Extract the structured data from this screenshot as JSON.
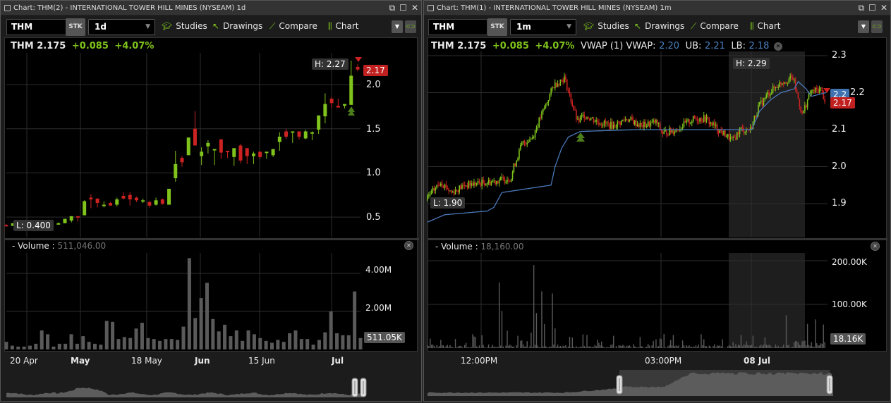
{
  "colors": {
    "up": "#7fc31c",
    "down": "#cc2222",
    "vwap": "#4a78b8",
    "grid": "#2e2e2e",
    "volume": "#5a5a5a",
    "price_tag": "#c02020",
    "vwap_tag": "#3f72b0"
  },
  "left": {
    "title": "Chart: THM(2) - INTERNATIONAL TOWER HILL MINES (NYSEAM) 1d",
    "symbol": "THM",
    "sec_type": "STK",
    "interval": "1d",
    "toolbar": {
      "studies": "Studies",
      "drawings": "Drawings",
      "compare": "Compare",
      "chart": "Chart"
    },
    "quote": {
      "symbol": "THM",
      "last": "2.175",
      "change": "+0.085",
      "change_pct": "+4.07%"
    },
    "high_label": "H: 2.27",
    "low_label": "L: 0.400",
    "price_tag": "2.17",
    "price_axis": [
      "2.0",
      "1.5",
      "1.0",
      "0.5"
    ],
    "volume": {
      "label": "- Volume :",
      "value": "511,046.00",
      "axis": [
        "4.00M",
        "2.00M"
      ],
      "tag": "511.05K"
    },
    "time_axis": [
      {
        "label": "20 Apr",
        "bold": false
      },
      {
        "label": "May",
        "bold": true
      },
      {
        "label": "18 May",
        "bold": false
      },
      {
        "label": "Jun",
        "bold": true
      },
      {
        "label": "15 Jun",
        "bold": false
      },
      {
        "label": "Jul",
        "bold": true
      }
    ]
  },
  "right": {
    "title": "Chart: THM(1) - INTERNATIONAL TOWER HILL MINES (NYSEAM) 1m",
    "symbol": "THM",
    "sec_type": "STK",
    "interval": "1m",
    "toolbar": {
      "studies": "Studies",
      "drawings": "Drawings",
      "compare": "Compare",
      "chart": "Chart"
    },
    "quote": {
      "symbol": "THM",
      "last": "2.175",
      "change": "+0.085",
      "change_pct": "+4.07%",
      "vwap_label": "VWAP (1) VWAP:",
      "vwap": "2.20",
      "ub_label": "UB:",
      "ub": "2.21",
      "lb_label": "LB:",
      "lb": "2.18"
    },
    "high_label": "H: 2.29",
    "low_label": "L: 1.90",
    "vwap_tag": "2.2",
    "price_tag": "2.17",
    "price_axis": [
      "2.3",
      "2.2",
      "2.1",
      "2.0",
      "1.9"
    ],
    "volume": {
      "label": "- Volume :",
      "value": "18,160.00",
      "axis": [
        "200.00K",
        "100.00K"
      ],
      "tag": "18.16K"
    },
    "time_axis": [
      {
        "label": "12:00PM",
        "bold": false
      },
      {
        "label": "03:00PM",
        "bold": false
      },
      {
        "label": "08 Jul",
        "bold": true
      }
    ]
  },
  "chart_data": [
    {
      "type": "candlestick",
      "name": "THM daily",
      "ylim": [
        0.3,
        2.35
      ],
      "ohlc": [
        [
          0.41,
          0.42,
          0.4,
          0.4
        ],
        [
          0.4,
          0.43,
          0.4,
          0.43
        ],
        [
          0.44,
          0.46,
          0.44,
          0.45
        ],
        [
          0.46,
          0.47,
          0.44,
          0.44
        ],
        [
          0.44,
          0.46,
          0.44,
          0.45
        ],
        [
          0.44,
          0.45,
          0.43,
          0.43
        ],
        [
          0.42,
          0.45,
          0.41,
          0.41
        ],
        [
          0.41,
          0.43,
          0.41,
          0.42
        ],
        [
          0.42,
          0.44,
          0.42,
          0.43
        ],
        [
          0.43,
          0.48,
          0.43,
          0.48
        ],
        [
          0.46,
          0.51,
          0.44,
          0.51
        ],
        [
          0.51,
          0.51,
          0.45,
          0.5
        ],
        [
          0.52,
          0.69,
          0.52,
          0.68
        ],
        [
          0.72,
          0.76,
          0.6,
          0.7
        ],
        [
          0.71,
          0.71,
          0.61,
          0.66
        ],
        [
          0.63,
          0.68,
          0.61,
          0.64
        ],
        [
          0.66,
          0.67,
          0.63,
          0.63
        ],
        [
          0.64,
          0.72,
          0.62,
          0.7
        ],
        [
          0.74,
          0.78,
          0.7,
          0.71
        ],
        [
          0.75,
          0.78,
          0.63,
          0.7
        ],
        [
          0.72,
          0.73,
          0.67,
          0.69
        ],
        [
          0.68,
          0.71,
          0.66,
          0.69
        ],
        [
          0.67,
          0.68,
          0.61,
          0.63
        ],
        [
          0.64,
          0.72,
          0.63,
          0.69
        ],
        [
          0.7,
          0.71,
          0.64,
          0.65
        ],
        [
          0.64,
          0.82,
          0.64,
          0.82
        ],
        [
          0.94,
          1.25,
          0.9,
          1.1
        ],
        [
          1.17,
          1.19,
          1.07,
          1.12
        ],
        [
          1.2,
          1.4,
          1.2,
          1.4
        ],
        [
          1.5,
          1.7,
          1.31,
          1.31
        ],
        [
          1.19,
          1.29,
          1.09,
          1.24
        ],
        [
          1.3,
          1.37,
          1.22,
          1.34
        ],
        [
          1.26,
          1.27,
          1.09,
          1.27
        ],
        [
          1.38,
          1.38,
          1.16,
          1.23
        ],
        [
          1.25,
          1.25,
          1.17,
          1.24
        ],
        [
          1.18,
          1.28,
          1.08,
          1.28
        ],
        [
          1.31,
          1.33,
          1.11,
          1.14
        ],
        [
          1.28,
          1.28,
          1.1,
          1.19
        ],
        [
          1.19,
          1.24,
          1.1,
          1.22
        ],
        [
          1.24,
          1.24,
          1.16,
          1.18
        ],
        [
          1.23,
          1.24,
          1.16,
          1.24
        ],
        [
          1.2,
          1.27,
          1.18,
          1.27
        ],
        [
          1.35,
          1.46,
          1.25,
          1.41
        ],
        [
          1.47,
          1.5,
          1.38,
          1.41
        ],
        [
          1.46,
          1.47,
          1.34,
          1.47
        ],
        [
          1.47,
          1.47,
          1.38,
          1.41
        ],
        [
          1.39,
          1.49,
          1.38,
          1.47
        ],
        [
          1.45,
          1.47,
          1.37,
          1.46
        ],
        [
          1.49,
          1.65,
          1.44,
          1.65
        ],
        [
          1.64,
          1.9,
          1.56,
          1.78
        ],
        [
          1.84,
          1.86,
          1.73,
          1.79
        ],
        [
          1.76,
          1.84,
          1.74,
          1.74
        ],
        [
          1.76,
          1.78,
          1.73,
          1.78
        ],
        [
          1.77,
          2.27,
          1.77,
          2.1
        ],
        [
          2.2,
          2.23,
          2.15,
          2.17
        ]
      ],
      "volume_m": [
        0.4,
        0.2,
        0.15,
        0.15,
        0.2,
        0.3,
        1.0,
        0.8,
        0.15,
        0.3,
        0.3,
        0.8,
        0.3,
        0.7,
        0.4,
        0.3,
        0.25,
        1.5,
        1.45,
        0.55,
        0.65,
        0.6,
        1.1,
        1.4,
        0.6,
        0.55,
        0.45,
        0.55,
        0.55,
        0.5,
        1.2,
        4.8,
        1.65,
        2.7,
        3.5,
        1.6,
        0.95,
        1.3,
        0.7,
        1.0,
        0.45,
        1.0,
        0.8,
        0.6,
        0.45,
        0.35,
        0.5,
        0.4,
        0.85,
        1.0,
        0.55,
        0.55,
        0.25,
        0.5,
        0.9,
        2.0,
        0.85,
        0.75,
        0.75,
        3.05,
        0.6
      ]
    },
    {
      "type": "candlestick",
      "name": "THM 1-minute",
      "bars": 300,
      "ylim": [
        1.84,
        2.31
      ],
      "price_path": [
        [
          0,
          1.91
        ],
        [
          11,
          1.96
        ],
        [
          19,
          1.93
        ],
        [
          29,
          1.95
        ],
        [
          50,
          1.96
        ],
        [
          64,
          1.97
        ],
        [
          66,
          2.0
        ],
        [
          72,
          2.06
        ],
        [
          80,
          2.08
        ],
        [
          88,
          2.15
        ],
        [
          96,
          2.22
        ],
        [
          104,
          2.24
        ],
        [
          109,
          2.18
        ],
        [
          114,
          2.12
        ],
        [
          119,
          2.14
        ],
        [
          130,
          2.12
        ],
        [
          141,
          2.11
        ],
        [
          151,
          2.13
        ],
        [
          162,
          2.11
        ],
        [
          173,
          2.12
        ],
        [
          178,
          2.09
        ],
        [
          188,
          2.1
        ],
        [
          202,
          2.13
        ],
        [
          210,
          2.13
        ],
        [
          220,
          2.1
        ],
        [
          231,
          2.07
        ],
        [
          236,
          2.1
        ],
        [
          244,
          2.1
        ],
        [
          250,
          2.16
        ],
        [
          258,
          2.2
        ],
        [
          268,
          2.23
        ],
        [
          276,
          2.24
        ],
        [
          283,
          2.14
        ],
        [
          289,
          2.2
        ],
        [
          297,
          2.21
        ],
        [
          300,
          2.18
        ]
      ],
      "vwap_path": [
        [
          0,
          1.85
        ],
        [
          13,
          1.87
        ],
        [
          45,
          1.88
        ],
        [
          50,
          1.89
        ],
        [
          56,
          1.93
        ],
        [
          93,
          1.95
        ],
        [
          96,
          2.0
        ],
        [
          101,
          2.05
        ],
        [
          106,
          2.08
        ],
        [
          115,
          2.095
        ],
        [
          157,
          2.1
        ],
        [
          244,
          2.1
        ],
        [
          250,
          2.15
        ],
        [
          258,
          2.18
        ],
        [
          266,
          2.2
        ],
        [
          276,
          2.21
        ],
        [
          279,
          2.23
        ],
        [
          285,
          2.21
        ],
        [
          289,
          2.19
        ],
        [
          300,
          2.2
        ]
      ],
      "volume_spikes_k": [
        [
          54,
          150
        ],
        [
          56,
          85
        ],
        [
          60,
          40
        ],
        [
          78,
          35
        ],
        [
          80,
          190
        ],
        [
          82,
          80
        ],
        [
          86,
          130
        ],
        [
          88,
          55
        ],
        [
          94,
          125
        ],
        [
          96,
          45
        ],
        [
          120,
          30
        ],
        [
          140,
          28
        ],
        [
          160,
          25
        ],
        [
          175,
          22
        ],
        [
          208,
          20
        ],
        [
          270,
          75
        ],
        [
          286,
          55
        ],
        [
          292,
          60
        ],
        [
          298,
          50
        ]
      ]
    }
  ]
}
